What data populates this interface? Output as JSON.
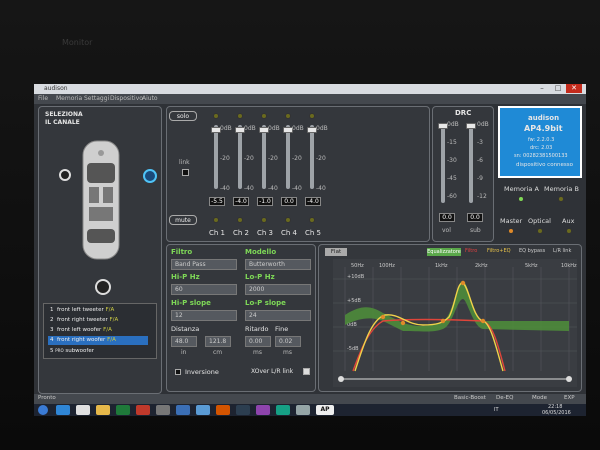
{
  "window": {
    "title": "audison",
    "controls": [
      "–",
      "□",
      "✕"
    ]
  },
  "menu": [
    "File",
    "Memoria",
    "Settaggi",
    "Dispositivo",
    "Aiuto"
  ],
  "channel_select": {
    "title_line1": "SELEZIONA",
    "title_line2": "IL CANALE",
    "channels": [
      {
        "num": "1",
        "label": "front left tweeter",
        "tag": "F/A"
      },
      {
        "num": "2",
        "label": "front right tweeter",
        "tag": "F/A"
      },
      {
        "num": "3",
        "label": "front left woofer",
        "tag": "F/A"
      },
      {
        "num": "4",
        "label": "front right woofer",
        "tag": "F/A"
      },
      {
        "num": "5",
        "label": "subwoofer",
        "prefix": "PRO"
      }
    ],
    "selected_index": 3
  },
  "mixer": {
    "solo_label": "solo",
    "link_label": "link",
    "mute_label": "mute",
    "scale": [
      "0dB",
      "-20",
      "-40"
    ],
    "channels": [
      {
        "name": "Ch 1",
        "value": "-5.5"
      },
      {
        "name": "Ch 2",
        "value": "-4.0"
      },
      {
        "name": "Ch 3",
        "value": "-1.0"
      },
      {
        "name": "Ch 4",
        "value": "0.0"
      },
      {
        "name": "Ch 5",
        "value": "-4.0"
      }
    ]
  },
  "drc": {
    "title": "DRC",
    "vol_scale": [
      "0dB",
      "-15",
      "-30",
      "-45",
      "-60"
    ],
    "sub_scale": [
      "0dB",
      "-3",
      "-6",
      "-9",
      "-12"
    ],
    "vol_value": "0.0",
    "sub_value": "0.0",
    "vol_label": "vol",
    "sub_label": "sub"
  },
  "device": {
    "brand": "audison",
    "model": "AP4.9bit",
    "fw": "fw: 2.2.0.3",
    "drc": "drc: 2.03",
    "serial": "sn: 00282381500133",
    "status": "dispositivo connesso"
  },
  "memory": {
    "a_label": "Memoria A",
    "b_label": "Memoria B"
  },
  "source": {
    "master": "Master",
    "optical": "Optical",
    "aux": "Aux"
  },
  "filter": {
    "filtro_label": "Filtro",
    "filtro_value": "Band Pass",
    "modello_label": "Modello",
    "modello_value": "Butterworth",
    "hip_hz_label": "Hi-P Hz",
    "hip_hz_value": "60",
    "lop_hz_label": "Lo-P Hz",
    "lop_hz_value": "2000",
    "hip_slope_label": "Hi-P slope",
    "hip_slope_value": "12",
    "lop_slope_label": "Lo-P slope",
    "lop_slope_value": "24",
    "distanza_label": "Distanza",
    "dist_in_value": "48.0",
    "dist_cm_value": "121.8",
    "in_label": "in",
    "cm_label": "cm",
    "ritardo_label": "Ritardo",
    "fine_label": "Fine",
    "ritardo_value": "0.00",
    "fine_value": "0.02",
    "ms_label": "ms",
    "inversione_label": "Inversione",
    "xover_label": "XOver L/R link"
  },
  "eq": {
    "flat_label": "Flat",
    "equalizzatore_label": "Equalizzatore",
    "filtro_label": "Filtro",
    "filtro_eq_label": "Filtro+EQ",
    "bypass_label": "EQ bypass",
    "lr_link_label": "L/R link",
    "freq_labels": [
      "50Hz",
      "100Hz",
      "1kHz",
      "2kHz",
      "5kHz",
      "10kHz"
    ],
    "db_labels": [
      "+10dB",
      "+5dB",
      "0dB",
      "-5dB"
    ]
  },
  "statusbar": {
    "left": "Pronto",
    "basic_boost": "Basic-Boost",
    "de_eq": "De-EQ",
    "mode": "Mode",
    "exp": "EXP"
  },
  "taskbar": {
    "lang": "IT",
    "time": "22:18",
    "date": "06/05/2016",
    "active_app": "AP"
  },
  "bezel_label": "Monitor"
}
